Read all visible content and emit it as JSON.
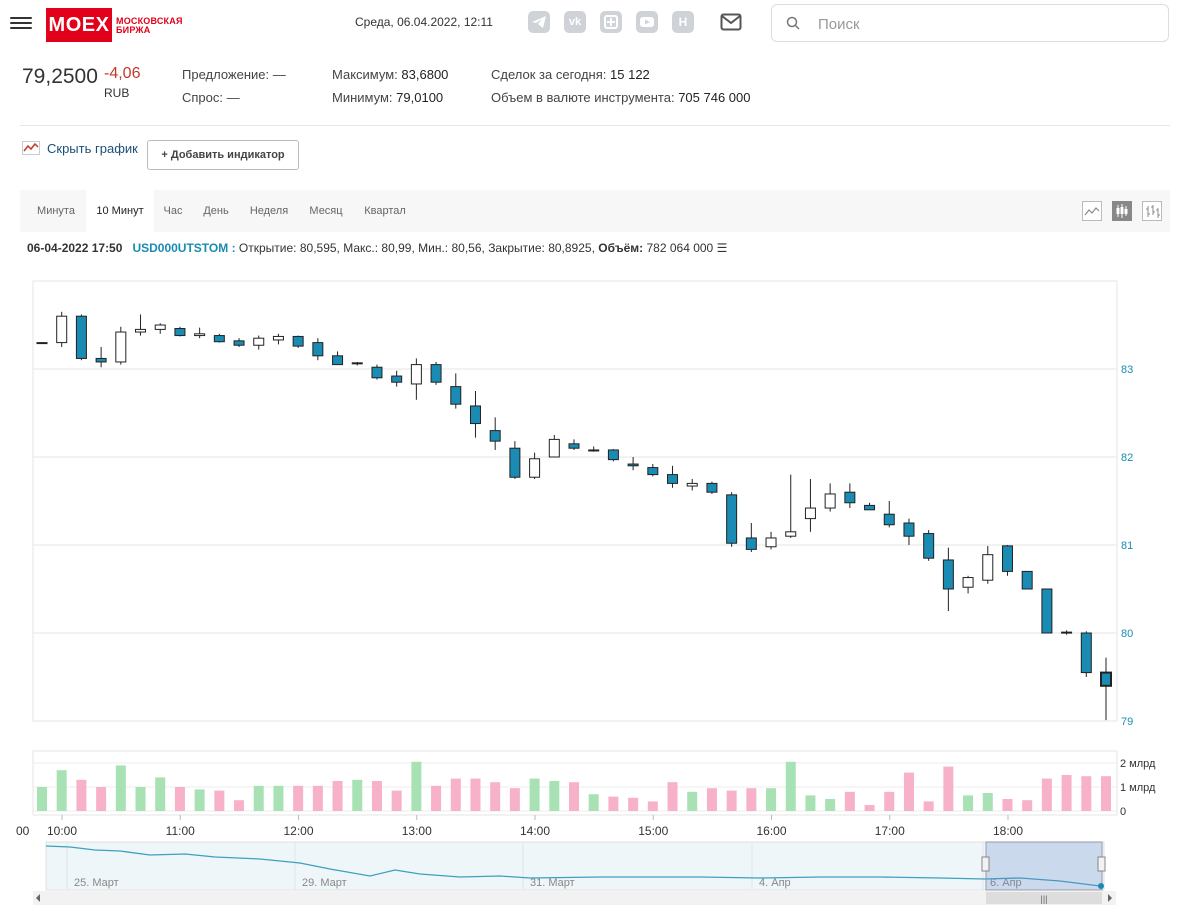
{
  "header": {
    "logo_text": "MOEX",
    "logo_sub1": "МОСКОВСКАЯ",
    "logo_sub2": "БИРЖА",
    "datetime": "Среда, 06.04.2022, 12:11",
    "social": [
      {
        "icon": "telegram-icon",
        "glyph": "➤"
      },
      {
        "icon": "vk-icon",
        "glyph": "vk"
      },
      {
        "icon": "zen-icon",
        "glyph": "✦"
      },
      {
        "icon": "youtube-icon",
        "glyph": "▶"
      },
      {
        "icon": "habr-icon",
        "glyph": "H"
      }
    ],
    "search_placeholder": "Поиск"
  },
  "quote": {
    "price": "79,2500",
    "change": "-4,06",
    "currency": "RUB",
    "offer_label": "Предложение:",
    "offer_value": "—",
    "bid_label": "Спрос:",
    "bid_value": "—",
    "max_label": "Максимум:",
    "max_value": "83,6800",
    "min_label": "Минимум:",
    "min_value": "79,0100",
    "deals_label": "Сделок за сегодня:",
    "deals_value": "15 122",
    "volume_label": "Объем в валюте инструмента:",
    "volume_value": "705 746 000"
  },
  "controls": {
    "hide_chart": "Скрыть график",
    "add_indicator": "Добавить индикатор"
  },
  "periods": [
    "Минута",
    "10 Минут",
    "Час",
    "День",
    "Неделя",
    "Месяц",
    "Квартал"
  ],
  "active_period": "10 Минут",
  "ohlc_info": {
    "datetime": "06-04-2022 17:50",
    "ticker": "USD000UTSTOM :",
    "open": "Открытие: 80,595,",
    "high": "Макс.: 80,99,",
    "low": "Мин.: 80,56,",
    "close": "Закрытие: 80,8925,",
    "volume_label": "Объём:",
    "volume": "782 064 000"
  },
  "colors": {
    "down": "#1a8bb3",
    "up": "#ffffff",
    "vol_up": "#a8e2b4",
    "vol_down": "#f7b1c8",
    "accent": "#e2001a"
  },
  "chart_data": {
    "type": "candlestick",
    "y_ticks": [
      83,
      82,
      81,
      80,
      79
    ],
    "ylim": [
      79,
      84.0
    ],
    "x_ticks": [
      "10:00",
      "11:00",
      "12:00",
      "13:00",
      "14:00",
      "15:00",
      "16:00",
      "17:00",
      "18:00"
    ],
    "x_tick_start_label": "00",
    "volume_ticks": [
      "2 млрд",
      "1 млрд",
      "0"
    ],
    "volume_max": 2.5,
    "candles": [
      {
        "o": 83.3,
        "h": 83.3,
        "l": 83.3,
        "c": 83.3,
        "v": 1.0
      },
      {
        "o": 83.3,
        "h": 83.65,
        "l": 83.25,
        "c": 83.6,
        "v": 1.7
      },
      {
        "o": 83.6,
        "h": 83.62,
        "l": 83.1,
        "c": 83.12,
        "v": 1.3
      },
      {
        "o": 83.12,
        "h": 83.25,
        "l": 83.02,
        "c": 83.08,
        "v": 1.0
      },
      {
        "o": 83.08,
        "h": 83.48,
        "l": 83.05,
        "c": 83.42,
        "v": 1.9
      },
      {
        "o": 83.42,
        "h": 83.62,
        "l": 83.38,
        "c": 83.45,
        "v": 1.0
      },
      {
        "o": 83.45,
        "h": 83.52,
        "l": 83.4,
        "c": 83.5,
        "v": 1.4
      },
      {
        "o": 83.46,
        "h": 83.48,
        "l": 83.37,
        "c": 83.38,
        "v": 1.0
      },
      {
        "o": 83.38,
        "h": 83.47,
        "l": 83.35,
        "c": 83.4,
        "v": 0.9
      },
      {
        "o": 83.38,
        "h": 83.4,
        "l": 83.3,
        "c": 83.31,
        "v": 0.85
      },
      {
        "o": 83.32,
        "h": 83.35,
        "l": 83.25,
        "c": 83.27,
        "v": 0.45
      },
      {
        "o": 83.27,
        "h": 83.38,
        "l": 83.22,
        "c": 83.35,
        "v": 1.05
      },
      {
        "o": 83.33,
        "h": 83.4,
        "l": 83.28,
        "c": 83.37,
        "v": 1.05
      },
      {
        "o": 83.37,
        "h": 83.38,
        "l": 83.24,
        "c": 83.26,
        "v": 1.05
      },
      {
        "o": 83.3,
        "h": 83.35,
        "l": 83.1,
        "c": 83.15,
        "v": 1.05
      },
      {
        "o": 83.15,
        "h": 83.2,
        "l": 83.05,
        "c": 83.05,
        "v": 1.25
      },
      {
        "o": 83.06,
        "h": 83.08,
        "l": 83.04,
        "c": 83.07,
        "v": 1.3
      },
      {
        "o": 83.02,
        "h": 83.05,
        "l": 82.88,
        "c": 82.9,
        "v": 1.25
      },
      {
        "o": 82.92,
        "h": 82.98,
        "l": 82.8,
        "c": 82.85,
        "v": 0.85
      },
      {
        "o": 82.83,
        "h": 83.12,
        "l": 82.65,
        "c": 83.05,
        "v": 2.05
      },
      {
        "o": 83.05,
        "h": 83.08,
        "l": 82.82,
        "c": 82.85,
        "v": 1.05
      },
      {
        "o": 82.8,
        "h": 82.95,
        "l": 82.55,
        "c": 82.6,
        "v": 1.35
      },
      {
        "o": 82.58,
        "h": 82.75,
        "l": 82.22,
        "c": 82.38,
        "v": 1.35
      },
      {
        "o": 82.3,
        "h": 82.45,
        "l": 82.08,
        "c": 82.18,
        "v": 1.2
      },
      {
        "o": 82.1,
        "h": 82.18,
        "l": 81.75,
        "c": 81.77,
        "v": 0.95
      },
      {
        "o": 81.77,
        "h": 82.05,
        "l": 81.75,
        "c": 81.98,
        "v": 1.35
      },
      {
        "o": 82.0,
        "h": 82.25,
        "l": 82.0,
        "c": 82.2,
        "v": 1.25
      },
      {
        "o": 82.15,
        "h": 82.2,
        "l": 82.08,
        "c": 82.1,
        "v": 1.2
      },
      {
        "o": 82.08,
        "h": 82.12,
        "l": 82.06,
        "c": 82.08,
        "v": 0.7
      },
      {
        "o": 82.08,
        "h": 82.09,
        "l": 81.95,
        "c": 81.97,
        "v": 0.6
      },
      {
        "o": 81.92,
        "h": 82.0,
        "l": 81.85,
        "c": 81.9,
        "v": 0.55
      },
      {
        "o": 81.88,
        "h": 81.92,
        "l": 81.78,
        "c": 81.8,
        "v": 0.4
      },
      {
        "o": 81.8,
        "h": 81.9,
        "l": 81.65,
        "c": 81.7,
        "v": 1.2
      },
      {
        "o": 81.67,
        "h": 81.75,
        "l": 81.62,
        "c": 81.7,
        "v": 0.8
      },
      {
        "o": 81.7,
        "h": 81.72,
        "l": 81.58,
        "c": 81.6,
        "v": 0.95
      },
      {
        "o": 81.57,
        "h": 81.6,
        "l": 80.98,
        "c": 81.02,
        "v": 0.85
      },
      {
        "o": 81.08,
        "h": 81.25,
        "l": 80.92,
        "c": 80.95,
        "v": 0.95
      },
      {
        "o": 80.98,
        "h": 81.15,
        "l": 80.95,
        "c": 81.08,
        "v": 0.95
      },
      {
        "o": 81.1,
        "h": 81.8,
        "l": 81.08,
        "c": 81.15,
        "v": 2.05
      },
      {
        "o": 81.3,
        "h": 81.75,
        "l": 81.15,
        "c": 81.42,
        "v": 0.65
      },
      {
        "o": 81.42,
        "h": 81.7,
        "l": 81.38,
        "c": 81.58,
        "v": 0.5
      },
      {
        "o": 81.6,
        "h": 81.7,
        "l": 81.42,
        "c": 81.48,
        "v": 0.8
      },
      {
        "o": 81.45,
        "h": 81.48,
        "l": 81.4,
        "c": 81.4,
        "v": 0.25
      },
      {
        "o": 81.35,
        "h": 81.5,
        "l": 81.2,
        "c": 81.23,
        "v": 0.8
      },
      {
        "o": 81.25,
        "h": 81.3,
        "l": 81.0,
        "c": 81.1,
        "v": 1.6
      },
      {
        "o": 81.13,
        "h": 81.17,
        "l": 80.82,
        "c": 80.85,
        "v": 0.4
      },
      {
        "o": 80.83,
        "h": 80.97,
        "l": 80.25,
        "c": 80.5,
        "v": 1.85
      },
      {
        "o": 80.52,
        "h": 80.65,
        "l": 80.45,
        "c": 80.63,
        "v": 0.65
      },
      {
        "o": 80.6,
        "h": 80.99,
        "l": 80.56,
        "c": 80.89,
        "v": 0.75
      },
      {
        "o": 80.99,
        "h": 81.0,
        "l": 80.65,
        "c": 80.7,
        "v": 0.5
      },
      {
        "o": 80.7,
        "h": 80.7,
        "l": 80.5,
        "c": 80.5,
        "v": 0.45
      },
      {
        "o": 80.5,
        "h": 80.5,
        "l": 80.0,
        "c": 80.0,
        "v": 1.35
      },
      {
        "o": 80.01,
        "h": 80.03,
        "l": 79.98,
        "c": 80.0,
        "v": 1.5
      },
      {
        "o": 80.0,
        "h": 80.02,
        "l": 79.5,
        "c": 79.55,
        "v": 1.45
      },
      {
        "o": 79.55,
        "h": 79.72,
        "l": 79.01,
        "c": 79.4,
        "v": 1.45
      }
    ]
  },
  "navigator": {
    "dates": [
      "25. Март",
      "29. Март",
      "31. Март",
      "4. Апр",
      "6. Апр"
    ]
  }
}
